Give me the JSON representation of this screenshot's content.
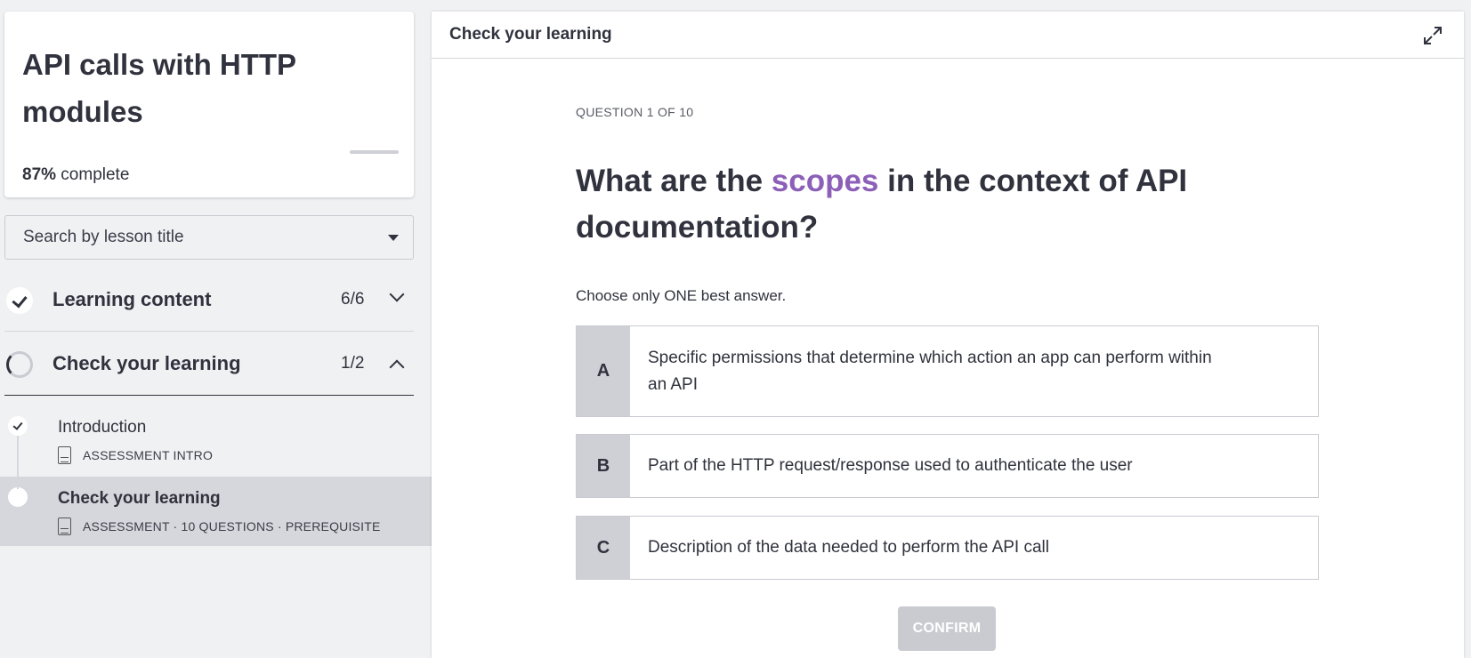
{
  "sidebar": {
    "course_title": "API calls with HTTP modules",
    "progress_percent": 87,
    "progress_value": "87%",
    "progress_suffix": " complete",
    "search_placeholder": "Search by lesson title",
    "sections": [
      {
        "title": "Learning content",
        "count": "6/6",
        "status": "complete",
        "expanded": false
      },
      {
        "title": "Check your learning",
        "count": "1/2",
        "status": "in-progress",
        "expanded": true
      }
    ],
    "lessons": [
      {
        "title": "Introduction",
        "meta": "ASSESSMENT INTRO",
        "icon": "text-doc-icon",
        "status": "complete"
      },
      {
        "title": "Check your learning",
        "meta": "ASSESSMENT · 10 QUESTIONS · PREREQUISITE",
        "icon": "quiz-doc-icon",
        "status": "current"
      }
    ]
  },
  "main": {
    "title": "Check your learning",
    "expand_icon": "expand-icon",
    "question_progress": "QUESTION 1 OF 10",
    "question_pre": "What are the ",
    "question_highlight": "scopes",
    "question_post": " in the context of API documentation?",
    "highlight_color": "#8c5fb8",
    "instruction": "Choose only ONE best answer.",
    "options": [
      {
        "letter": "A",
        "text": "Specific permissions that determine which action an app can perform within an API"
      },
      {
        "letter": "B",
        "text": "Part of the HTTP request/response used to authenticate the user"
      },
      {
        "letter": "C",
        "text": "Description of the data needed to perform the API call"
      }
    ],
    "confirm_label": "CONFIRM"
  }
}
